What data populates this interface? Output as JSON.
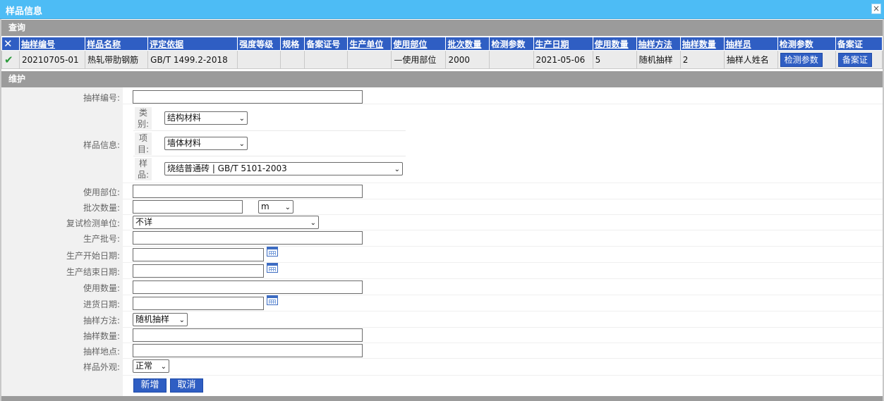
{
  "window": {
    "title": "样品信息",
    "close": "×"
  },
  "sections": {
    "query": "查询",
    "maintain": "维护"
  },
  "table": {
    "headers": [
      "抽样编号",
      "样品名称",
      "评定依据",
      "强度等级",
      "规格",
      "备案证号",
      "生产单位",
      "使用部位",
      "批次数量",
      "检测参数",
      "生产日期",
      "使用数量",
      "抽样方法",
      "抽样数量",
      "抽样员",
      "检测参数",
      "备案证"
    ],
    "row": {
      "check": "✔",
      "sample_no": "20210705-01",
      "sample_name": "热轧带肋钢筋",
      "basis": "GB/T 1499.2-2018",
      "strength": "",
      "spec": "",
      "record_no": "",
      "producer": "",
      "use_location": "—使用部位",
      "batch_qty": "2000",
      "test_params": "",
      "prod_date": "2021-05-06",
      "use_qty": "5",
      "method": "随机抽样",
      "sample_qty": "2",
      "sampler": "抽样人姓名",
      "btn_params": "检测参数",
      "btn_record": "备案证"
    }
  },
  "form": {
    "sample_no": {
      "label": "抽样编号:",
      "value": ""
    },
    "sample_info": {
      "label": "样品信息:",
      "category_label": "类别:",
      "category_value": "结构材料",
      "item_label": "项目:",
      "item_value": "墙体材料",
      "sample_label": "样品:",
      "sample_value": "烧结普通砖 | GB/T 5101-2003"
    },
    "use_location": {
      "label": "使用部位:",
      "value": ""
    },
    "batch_qty": {
      "label": "批次数量:",
      "value": "",
      "unit": "m"
    },
    "retest_unit": {
      "label": "复试检测单位:",
      "value": "不详"
    },
    "prod_batch": {
      "label": "生产批号:",
      "value": ""
    },
    "prod_start": {
      "label": "生产开始日期:",
      "value": ""
    },
    "prod_end": {
      "label": "生产结束日期:",
      "value": ""
    },
    "use_qty": {
      "label": "使用数量:",
      "value": ""
    },
    "purchase_date": {
      "label": "进货日期:",
      "value": ""
    },
    "method": {
      "label": "抽样方法:",
      "value": "随机抽样"
    },
    "sample_qty": {
      "label": "抽样数量:",
      "value": ""
    },
    "location": {
      "label": "抽样地点:",
      "value": ""
    },
    "appearance": {
      "label": "样品外观:",
      "value": "正常"
    },
    "buttons": {
      "add": "新增",
      "cancel": "取消"
    }
  },
  "icons": {
    "delete": "x-icon",
    "check": "check-icon",
    "calendar": "calendar-icon",
    "dropdown": "chevron-down-icon"
  },
  "colors": {
    "titlebar": "#4dbcf5",
    "header": "#2f5ec3",
    "section": "#9b9b9b",
    "check": "#2b9a3a"
  }
}
